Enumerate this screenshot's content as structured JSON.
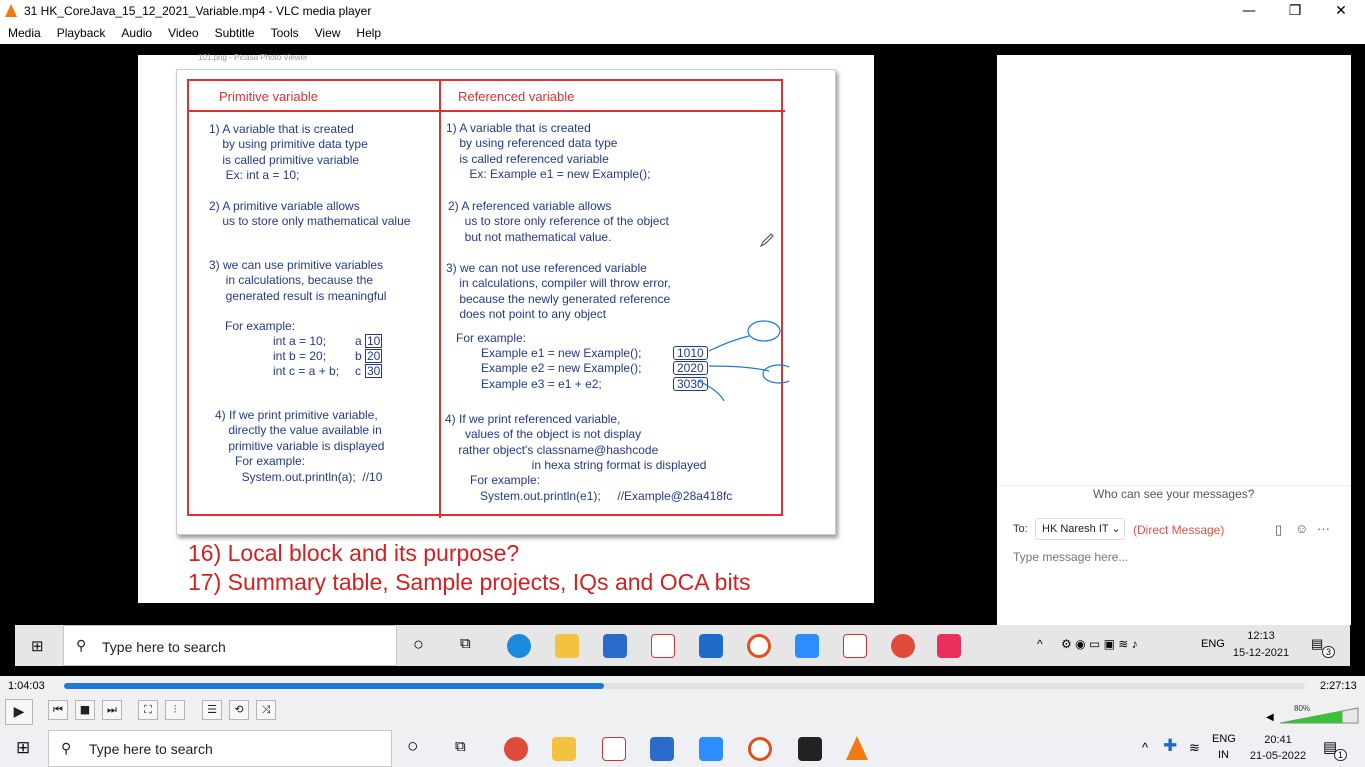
{
  "window": {
    "title": "31 HK_CoreJava_15_12_2021_Variable.mp4 - VLC media player",
    "minimize": "—",
    "restore": "❐",
    "close": "✕"
  },
  "menu": [
    "Media",
    "Playback",
    "Audio",
    "Video",
    "Subtitle",
    "Tools",
    "View",
    "Help"
  ],
  "slide": {
    "viewer_title": "101.png - Picasa Photo Viewer",
    "left_header": "Primitive variable",
    "right_header": "Referenced variable",
    "left": {
      "p1": "1) A variable that is created\n    by using primitive data type\n    is called primitive variable\n     Ex: int a = 10;",
      "p2": "2) A primitive variable allows\n    us to store only mathematical value",
      "p3": "3) we can use primitive variables\n     in calculations, because the\n     generated result is meaningful",
      "example_label": "For example:",
      "ex_lines": [
        "int a = 10;",
        "int b = 20;",
        "int c = a + b;"
      ],
      "ex_vars": [
        "a",
        "b",
        "c"
      ],
      "ex_vals": [
        "10",
        "20",
        "30"
      ],
      "p4": "4) If we print primitive variable,\n    directly the value available in\n    primitive variable is displayed\n      For example:\n        System.out.println(a);  //10"
    },
    "right": {
      "p1": "1) A variable that is created\n    by using referenced data type\n    is called referenced variable\n       Ex: Example e1 = new Example();",
      "p2": "2) A referenced variable allows\n     us to store only reference of the object\n     but not mathematical value.",
      "p3": "3) we can not use referenced variable\n    in calculations, compiler will throw error,\n    because the newly generated reference\n    does not point to any object",
      "example_label": "For example:",
      "ex_lines": [
        "Example e1 = new Example();",
        "Example e2 = new Example();",
        "Example e3 = e1 + e2;"
      ],
      "ex_refs": [
        "1010",
        "2020",
        "3030"
      ],
      "p4": "4) If we print referenced variable,\n      values of the object is not display\n    rather object's classname@hashcode\n                          in hexa string format is displayed",
      "p4_example_label": "For example:",
      "p4_example_code": "System.out.println(e1);     //Example@28a418fc"
    },
    "line16": "16) Local block and its purpose?",
    "line17": "17) Summary table, Sample projects, IQs and OCA bits"
  },
  "chat": {
    "who_can_see": "Who can see your messages?",
    "to_label": "To:",
    "recipient": "HK Naresh IT",
    "direct_message": "(Direct Message)",
    "placeholder": "Type message here..."
  },
  "inner_taskbar": {
    "search": "Type here to search",
    "lang": "ENG",
    "time": "12:13",
    "date": "15-12-2021",
    "notif_count": "3"
  },
  "player": {
    "elapsed": "1:04:03",
    "total": "2:27:13",
    "progress_fraction": 0.435,
    "volume": "80%",
    "volume_fraction": 0.8
  },
  "taskbar": {
    "search": "Type here to search",
    "lang_top": "ENG",
    "lang_bottom": "IN",
    "time": "20:41",
    "date": "21-05-2022",
    "notif_count": "1"
  }
}
